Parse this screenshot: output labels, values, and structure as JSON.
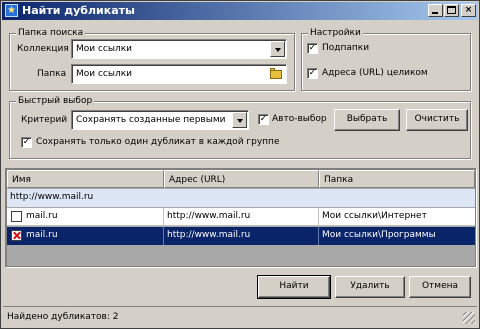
{
  "window": {
    "title": "Найти дубликаты",
    "title_icon": "star-icon",
    "controls": [
      "minimize",
      "maximize",
      "close"
    ]
  },
  "search_folder": {
    "legend": "Папка поиска",
    "collection_label": "Коллекция",
    "collection_value": "Мои ссылки",
    "folder_label": "Папка",
    "folder_value": "Мои ссылки"
  },
  "settings": {
    "legend": "Настройки",
    "subfolders_label": "Подпапки",
    "subfolders_checked": true,
    "full_url_label": "Адреса (URL) целиком",
    "full_url_checked": true
  },
  "quick_select": {
    "legend": "Быстрый выбор",
    "criterion_label": "Критерий",
    "criterion_value": "Сохранять созданные первыми",
    "auto_select_label": "Авто-выбор",
    "auto_select_checked": true,
    "select_button": "Выбрать",
    "clear_button": "Очистить",
    "keep_one_label": "Сохранять только один дубликат в каждой группе",
    "keep_one_checked": true
  },
  "table": {
    "columns": [
      "Имя",
      "Адрес (URL)",
      "Папка"
    ],
    "group_label": "http://www.mail.ru",
    "rows": [
      {
        "name": "mail.ru",
        "url": "http://www.mail.ru",
        "folder": "Мои ссылки\\Интернет",
        "mark": "empty",
        "selected": false
      },
      {
        "name": "mail.ru",
        "url": "http://www.mail.ru",
        "folder": "Мои ссылки\\Программы",
        "mark": "delete",
        "selected": true
      }
    ]
  },
  "buttons": {
    "find": "Найти",
    "delete": "Удалить",
    "cancel": "Отмена"
  },
  "status": {
    "text": "Найдено дубликатов: 2"
  },
  "colors": {
    "title_bar": "#0a246a",
    "selection": "#0a246a",
    "group_row": "#dde6f4",
    "window_bg": "#d4d0c8"
  }
}
